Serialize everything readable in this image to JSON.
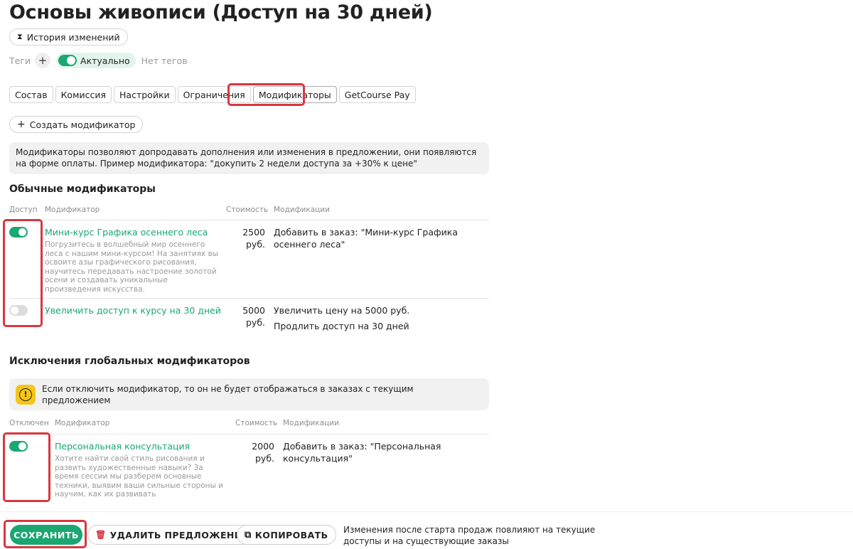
{
  "page": {
    "title": "Основы живописи (Доступ на 30 дней)",
    "history_button": "История изменений",
    "tags_label": "Теги",
    "actual_label": "Актуально",
    "no_tags": "Нет тегов"
  },
  "tabs": [
    {
      "label": "Состав"
    },
    {
      "label": "Комиссия"
    },
    {
      "label": "Настройки"
    },
    {
      "label": "Ограничения"
    },
    {
      "label": "Модификаторы",
      "active": true
    },
    {
      "label": "GetCourse Pay"
    }
  ],
  "create_button": "Создать модификатор",
  "info_text": "Модификаторы позволяют допродавать дополнения или изменения в предложении, они появляются на форме оплаты. Пример модификатора: \"докупить 2 недели доступа за +30% к цене\"",
  "regular": {
    "title": "Обычные модификаторы",
    "headers": {
      "access": "Доступ",
      "modifier": "Модификатор",
      "cost": "Стоимость",
      "changes": "Модификации"
    },
    "rows": [
      {
        "enabled": true,
        "name": "Мини-курс Графика осеннего леса",
        "description": "Погрузитесь в волшебный мир осеннего леса с нашим мини-курсом! На занятиях вы освоите азы графического рисования, научитесь передавать настроение золотой осени и создавать уникальные произведения искусства.",
        "price": "2500 руб.",
        "changes": [
          "Добавить в заказ: \"Мини-курс Графика осеннего леса\""
        ]
      },
      {
        "enabled": false,
        "name": "Увеличить доступ к курсу на 30 дней",
        "description": "",
        "price": "5000 руб.",
        "changes": [
          "Увеличить цену на 5000 руб.",
          "Продлить доступ на 30 дней"
        ]
      }
    ]
  },
  "global": {
    "title": "Исключения глобальных модификаторов",
    "warning": "Если отключить модификатор, то он не будет отображаться в заказах с текущим предложением",
    "headers": {
      "disabled": "Отключен",
      "modifier": "Модификатор",
      "cost": "Стоимость",
      "changes": "Модификации"
    },
    "rows": [
      {
        "enabled": true,
        "name": "Персональная консультация",
        "description": "Хотите найти свой стиль рисования и развить художественные навыки? За время сессии мы разберем основные техники, выявим ваши сильные стороны и научим, как их развивать",
        "price": "2000 руб.",
        "changes": [
          "Добавить в заказ: \"Персональная консультация\""
        ]
      }
    ]
  },
  "footer": {
    "save": "СОХРАНИТЬ",
    "delete": "УДАЛИТЬ ПРЕДЛОЖЕНИЕ",
    "copy": "КОПИРОВАТЬ",
    "note": "Изменения после старта продаж повлияют на текущие доступы и на существующие заказы"
  },
  "colors": {
    "accent": "#1aa772",
    "highlight": "#d9363e",
    "warning": "#f5c518"
  }
}
